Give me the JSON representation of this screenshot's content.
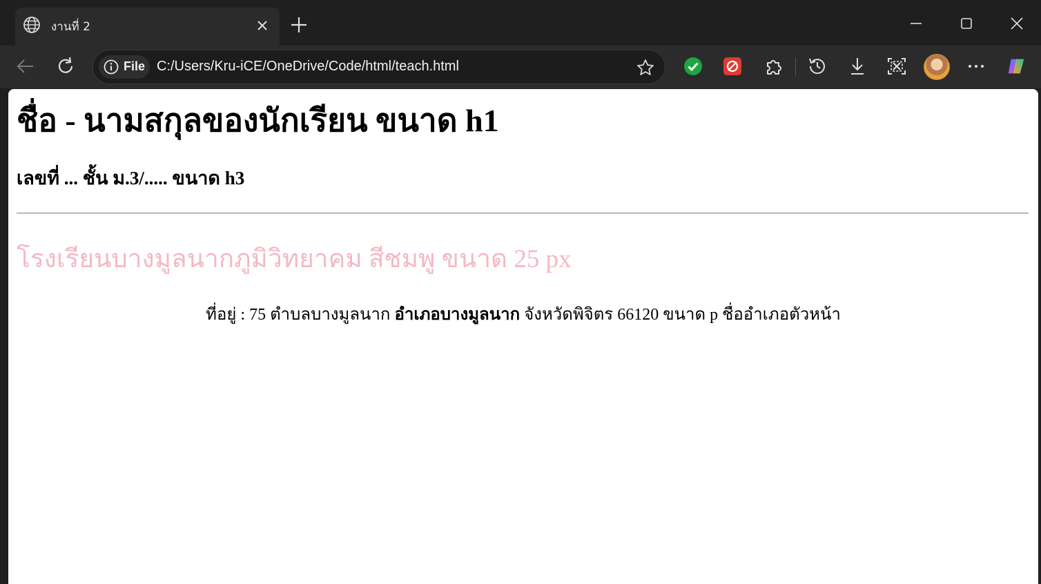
{
  "browser": {
    "tab": {
      "title": "งานที่ 2"
    },
    "address_bar": {
      "scheme_label": "File",
      "url": "C:/Users/Kru-iCE/OneDrive/Code/html/teach.html"
    },
    "icons": {
      "back": "arrow-left-icon",
      "reload": "refresh-icon",
      "info": "info-icon",
      "favorite": "star-icon",
      "ext1": "green-check-extension-icon",
      "ext2": "red-extension-icon",
      "extensions": "puzzle-icon",
      "history": "history-icon",
      "downloads": "download-icon",
      "screenshot": "screenshot-icon",
      "profile": "avatar",
      "more": "more-icon",
      "copilot": "copilot-icon"
    },
    "colors": {
      "chrome_bg": "#1f1f1f",
      "toolbar_bg": "#2b2b2b",
      "ext_green": "#1fa542",
      "ext_red": "#e03a31"
    }
  },
  "page": {
    "h1": "ชื่อ - นามสกุลของนักเรียน ขนาด h1",
    "h3": "เลขที่ ... ชั้น ม.3/..... ขนาด h3",
    "school": {
      "text": "โรงเรียนบางมูลนากภูมิวิทยาคม สีชมพู ขนาด 25 px",
      "color": "#f4b8c4"
    },
    "address": {
      "before": "ที่อยู่ : 75 ตำบลบางมูลนาก ",
      "bold": "อำเภอบางมูลนาก",
      "after": " จังหวัดพิจิตร 66120 ขนาด p ชื่ออำเภอตัวหน้า"
    }
  }
}
